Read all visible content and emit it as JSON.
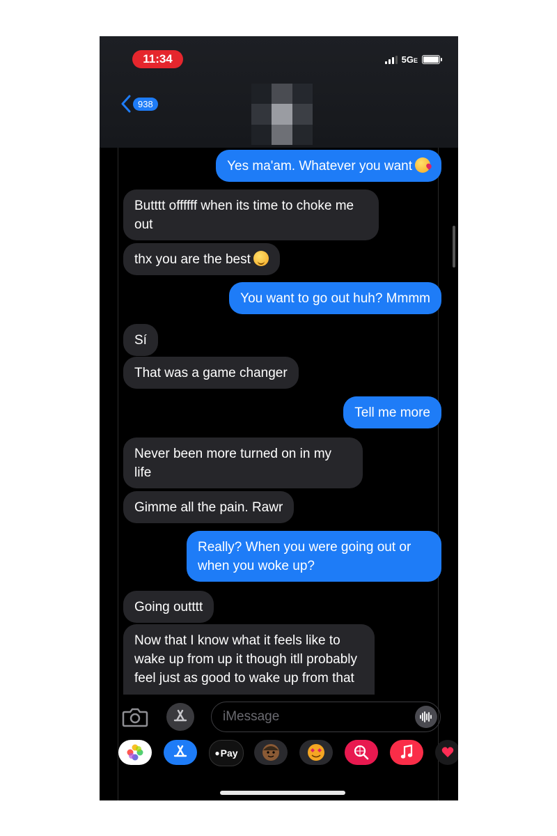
{
  "status_bar": {
    "time": "11:34",
    "network": "5G",
    "network_sub": "E"
  },
  "header": {
    "back_count": "938",
    "contact_avatar": "pixelated-avatar"
  },
  "messages": [
    {
      "dir": "out",
      "text": "Yes ma'am. Whatever you want",
      "emoji": "kissing-face"
    },
    {
      "dir": "in",
      "text": "Butttt offffff when its time to choke me out"
    },
    {
      "dir": "in",
      "text": "thx you are the best",
      "emoji": "winking-face"
    },
    {
      "dir": "out",
      "text": "You want to go out huh? Mmmm"
    },
    {
      "dir": "in",
      "text": "Sí"
    },
    {
      "dir": "in",
      "text": "That was a game changer"
    },
    {
      "dir": "out",
      "text": "Tell me more"
    },
    {
      "dir": "in",
      "text": "Never been more turned on in my life"
    },
    {
      "dir": "in",
      "text": "Gimme all the pain. Rawr"
    },
    {
      "dir": "out",
      "text": "Really? When you were going out or when you woke up?"
    },
    {
      "dir": "in",
      "text": "Going outttt"
    },
    {
      "dir": "in",
      "text": "Now that I know what it feels like to wake up from up it though itll probably feel just as good to wake up from that"
    }
  ],
  "composer": {
    "placeholder": "iMessage"
  },
  "app_tray": [
    {
      "name": "photos",
      "label": ""
    },
    {
      "name": "app-store",
      "label": ""
    },
    {
      "name": "apple-pay",
      "label": "Pay"
    },
    {
      "name": "memoji",
      "label": ""
    },
    {
      "name": "memoji-stickers",
      "label": ""
    },
    {
      "name": "images-search",
      "label": ""
    },
    {
      "name": "music",
      "label": ""
    },
    {
      "name": "digital-touch",
      "label": ""
    }
  ],
  "colors": {
    "outgoing_bubble": "#1e7cf7",
    "incoming_bubble": "#26262a",
    "time_pill": "#e5262d",
    "background": "#000000"
  }
}
